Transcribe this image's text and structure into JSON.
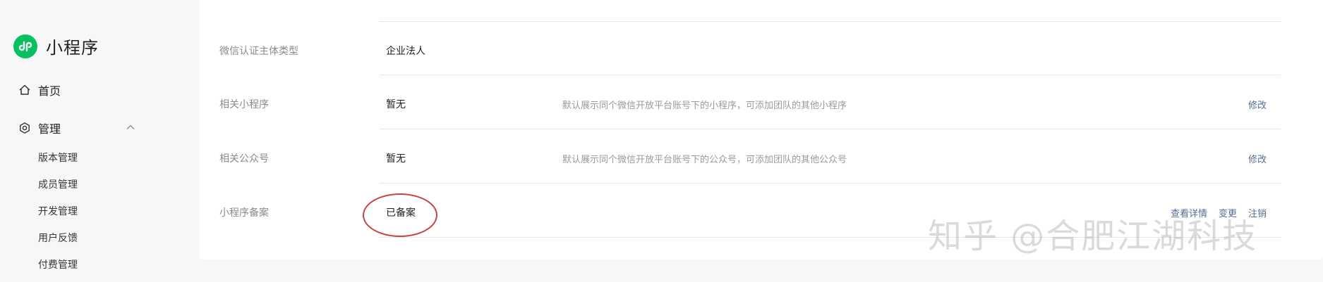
{
  "sidebar": {
    "brand_title": "小程序",
    "home": "首页",
    "manage": "管理",
    "sub_items": [
      "版本管理",
      "成员管理",
      "开发管理",
      "用户反馈",
      "付费管理"
    ]
  },
  "rows": [
    {
      "label": "微信认证主体类型",
      "value": "企业法人",
      "desc": "",
      "action": ""
    },
    {
      "label": "相关小程序",
      "value": "暂无",
      "desc": "默认展示同个微信开放平台账号下的小程序，可添加团队的其他小程序",
      "action": "修改"
    },
    {
      "label": "相关公众号",
      "value": "暂无",
      "desc": "默认展示同个微信开放平台账号下的公众号，可添加团队的其他公众号",
      "action": "修改"
    },
    {
      "label": "小程序备案",
      "value": "已备案",
      "desc": "",
      "actions": [
        "查看详情",
        "变更",
        "注销"
      ]
    }
  ],
  "watermark": "知乎 @合肥江湖科技",
  "colors": {
    "brand": "#07c160",
    "link": "#576b95",
    "annotation": "#c8403f"
  }
}
